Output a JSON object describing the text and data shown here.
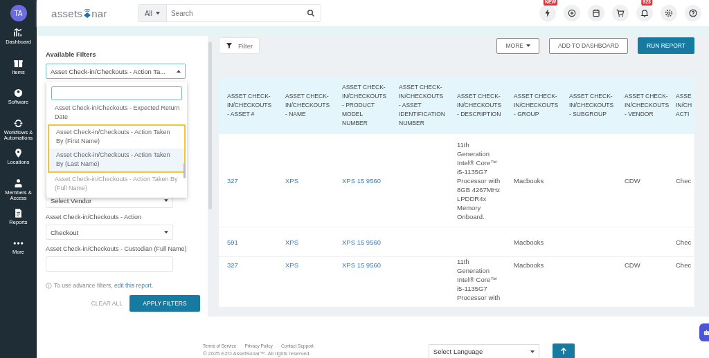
{
  "sidebar": {
    "avatar": "TA",
    "items": [
      {
        "label": "Dashboard"
      },
      {
        "label": "Items"
      },
      {
        "label": "Software"
      },
      {
        "label": "Workflows & Automations"
      },
      {
        "label": "Locations"
      },
      {
        "label": "Members & Access"
      },
      {
        "label": "Reports"
      },
      {
        "label": "More"
      }
    ]
  },
  "header": {
    "logo": {
      "prefix": "assets",
      "suffix": "nar"
    },
    "search": {
      "scope": "All",
      "placeholder": "Search"
    },
    "badges": [
      "NEW",
      "923"
    ]
  },
  "filters": {
    "title": "Available Filters",
    "selected_filter": "Asset Check-in/Checkouts - Action Ta...",
    "dropdown": {
      "options": [
        {
          "label": "Asset Check-in/Checkouts - Expected Return Date",
          "boxed": false,
          "hovered": false,
          "faded": false
        },
        {
          "label": "Asset Check-in/Checkouts - Action Taken By (First Name)",
          "boxed": true,
          "hovered": false,
          "faded": false
        },
        {
          "label": "Asset Check-in/Checkouts - Action Taken By (Last Name)",
          "boxed": true,
          "hovered": true,
          "faded": false
        },
        {
          "label": "Asset Check-in/Checkouts - Action Taken By (Full Name)",
          "boxed": false,
          "hovered": false,
          "faded": true
        }
      ]
    },
    "fields": [
      {
        "kind": "select",
        "value": "Select Vendor"
      },
      {
        "kind": "select",
        "label": "Asset Check-in/Checkouts - Action",
        "value": "Checkout"
      },
      {
        "kind": "text",
        "label": "Asset Check-in/Checkouts - Custodian (Full Name)"
      }
    ],
    "note": "To use advance filters,",
    "note_link": "edit this report.",
    "clear": "CLEAR ALL",
    "apply": "APPLY FILTERS"
  },
  "toolbar": {
    "filter": "Filter",
    "more": "MORE",
    "add": "ADD TO DASHBOARD",
    "run": "RUN REPORT"
  },
  "table": {
    "columns": [
      "ASSET CHECK-IN/CHECKOUTS - ASSET #",
      "ASSET CHECK-IN/CHECKOUTS - NAME",
      "ASSET CHECK-IN/CHECKOUTS - PRODUCT MODEL NUMBER",
      "ASSET CHECK-IN/CHECKOUTS - ASSET IDENTIFICATION NUMBER",
      "ASSET CHECK-IN/CHECKOUTS - DESCRIPTION",
      "ASSET CHECK-IN/CHECKOUTS - GROUP",
      "ASSET CHECK-IN/CHECKOUTS - SUBGROUP",
      "ASSET CHECK-IN/CHECKOUTS - VENDOR",
      "ASSE IN/CH ACTI"
    ],
    "rows": [
      [
        "327",
        "XPS",
        "XPS 15 9560",
        "",
        "11th Generation Intel® Core™ i5-1135G7 Processor with 8GB 4267MHz LPDDR4x Memory Onboard.",
        "Macbooks",
        "",
        "CDW",
        "Chec"
      ],
      [
        "591",
        "XPS",
        "XPS 15 9560",
        "",
        "",
        "Macbooks",
        "",
        "",
        "Chec"
      ],
      [
        "327",
        "XPS",
        "XPS 15 9560",
        "",
        "11th Generation Intel® Core™ i5-1135G7 Processor with",
        "Macbooks",
        "",
        "CDW",
        "Chec"
      ]
    ]
  },
  "footer": {
    "links": [
      "Terms of Service",
      "Privacy Policy",
      "Contact Support"
    ],
    "copyright": "© 2025 EZO AssetSonar™. All rights reserved.",
    "language": "Select Language"
  }
}
